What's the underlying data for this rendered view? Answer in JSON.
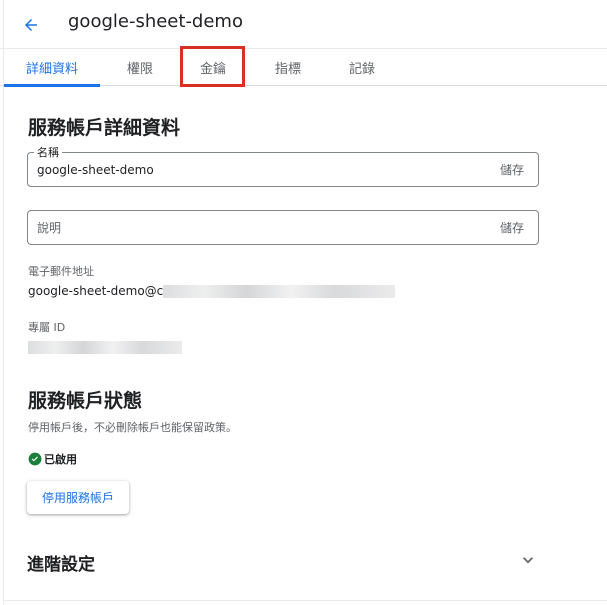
{
  "header": {
    "title": "google-sheet-demo",
    "back_icon": "arrow-back-icon"
  },
  "tabs": [
    {
      "label": "詳細資料",
      "active": true
    },
    {
      "label": "權限",
      "active": false
    },
    {
      "label": "金鑰",
      "active": false,
      "highlighted": true
    },
    {
      "label": "指標",
      "active": false
    },
    {
      "label": "記錄",
      "active": false
    }
  ],
  "details": {
    "section_title": "服務帳戶詳細資料",
    "name_field": {
      "label": "名稱",
      "value": "google-sheet-demo",
      "save_label": "儲存"
    },
    "description_field": {
      "placeholder": "說明",
      "save_label": "儲存"
    },
    "email": {
      "label": "電子郵件地址",
      "value_prefix": "google-sheet-demo@c"
    },
    "unique_id": {
      "label": "專屬 ID"
    }
  },
  "status": {
    "section_title": "服務帳戶狀態",
    "description": "停用帳戶後，不必刪除帳戶也能保留政策。",
    "state": "已啟用",
    "state_color": "#188038",
    "disable_button": "停用服務帳戶"
  },
  "advanced": {
    "title": "進階設定",
    "icon": "chevron-down-icon"
  },
  "colors": {
    "accent": "#1a73e8",
    "highlight": "#d93025"
  }
}
